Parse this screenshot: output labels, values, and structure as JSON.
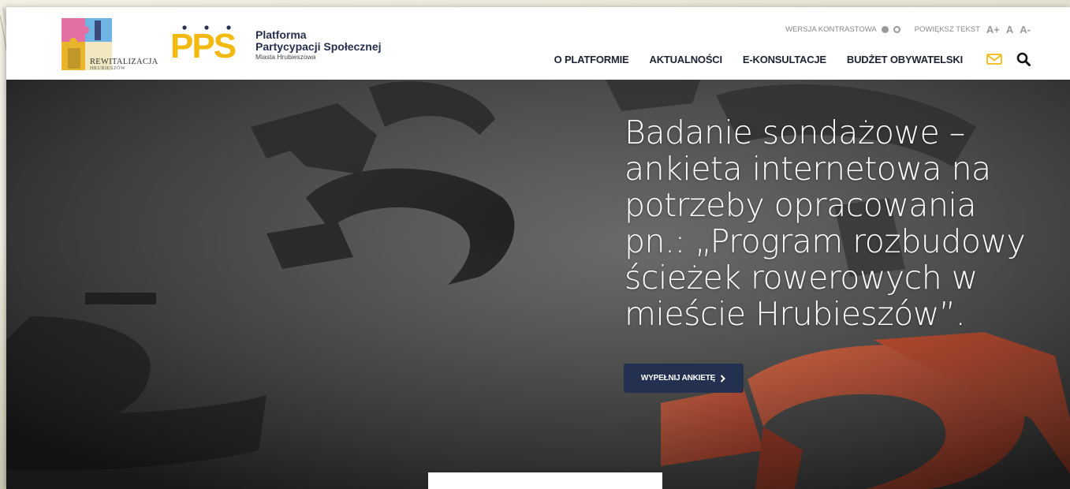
{
  "colors": {
    "brand_navy": "#24304f",
    "brand_yellow": "#f2b90f",
    "mail_icon": "#f2b90f",
    "question_mark_red": "#ff4a1c"
  },
  "logos": {
    "rewitalizacja_title": "REWITALIZACJA",
    "rewitalizacja_sub": "HRUBIESZÓW",
    "pps_mark": "PPS"
  },
  "brand": {
    "line1": "Platforma",
    "line2": "Partycypacji Społecznej",
    "line3": "Miasta Hrubieszowa"
  },
  "accessibility": {
    "contrast_label": "WERSJA KONTRASTOWA",
    "text_size_label": "POWIĘKSZ TEKST",
    "size_plus": "A+",
    "size_normal": "A",
    "size_minus": "A-"
  },
  "nav": {
    "items": [
      {
        "label": "O PLATFORMIE"
      },
      {
        "label": "AKTUALNOŚCI"
      },
      {
        "label": "E-KONSULTACJE"
      },
      {
        "label": "BUDŻET OBYWATELSKI"
      }
    ],
    "icons": [
      "mail-icon",
      "search-icon"
    ]
  },
  "hero": {
    "title": "Badanie sondażowe – ankieta internetowa na potrzeby opracowania pn.: „Program rozbudowy ścieżek rowerowych w mieście Hrubieszów”.",
    "cta_label": "WYPEŁNIJ ANKIETĘ",
    "cta_icon": "chevron-right-icon"
  }
}
